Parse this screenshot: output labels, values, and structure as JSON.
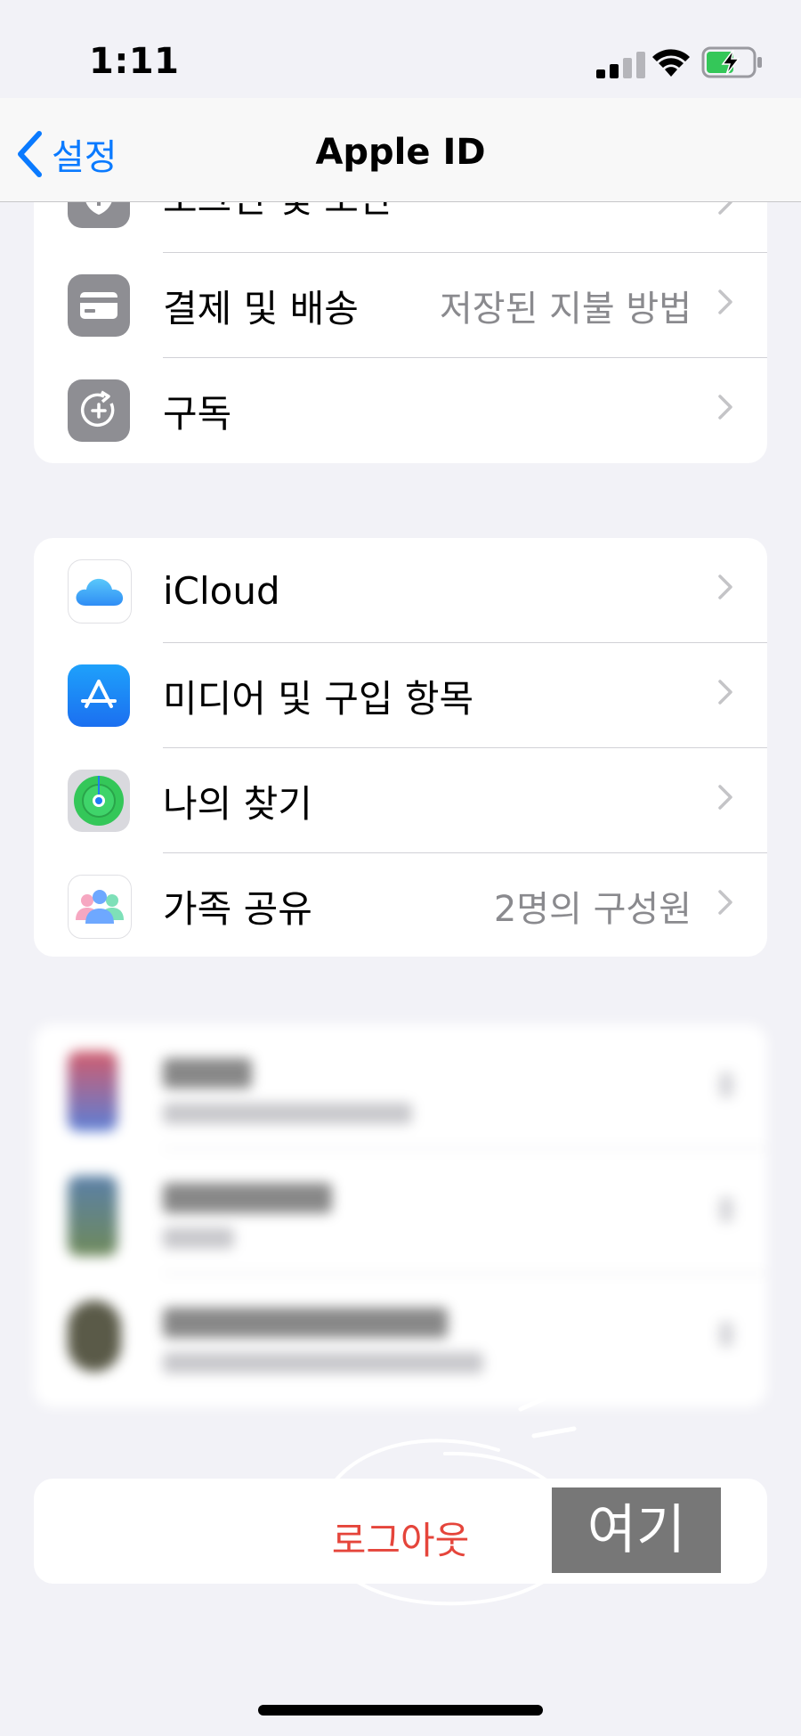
{
  "status_bar": {
    "time": "1:11",
    "signal_icon": "cellular-signal-icon",
    "wifi_icon": "wifi-icon",
    "battery_icon": "battery-charging-icon"
  },
  "nav": {
    "back_label": "설정",
    "title": "Apple ID"
  },
  "group1": {
    "partial_label": "로그인 및 보안",
    "rows": [
      {
        "label": "결제 및 배송",
        "value": "저장된 지불 방법",
        "icon": "credit-card-icon"
      },
      {
        "label": "구독",
        "value": "",
        "icon": "subscription-icon"
      }
    ]
  },
  "group2": {
    "rows": [
      {
        "label": "iCloud",
        "value": "",
        "icon": "icloud-icon"
      },
      {
        "label": "미디어 및 구입 항목",
        "value": "",
        "icon": "app-store-icon"
      },
      {
        "label": "나의 찾기",
        "value": "",
        "icon": "find-my-icon"
      },
      {
        "label": "가족 공유",
        "value": "2명의 구성원",
        "icon": "family-sharing-icon"
      }
    ]
  },
  "sign_out": {
    "label": "로그아웃"
  },
  "annotation": {
    "text": "여기"
  },
  "colors": {
    "accent": "#0a7aff",
    "destructive": "#e5453b",
    "background": "#f2f2f7"
  }
}
